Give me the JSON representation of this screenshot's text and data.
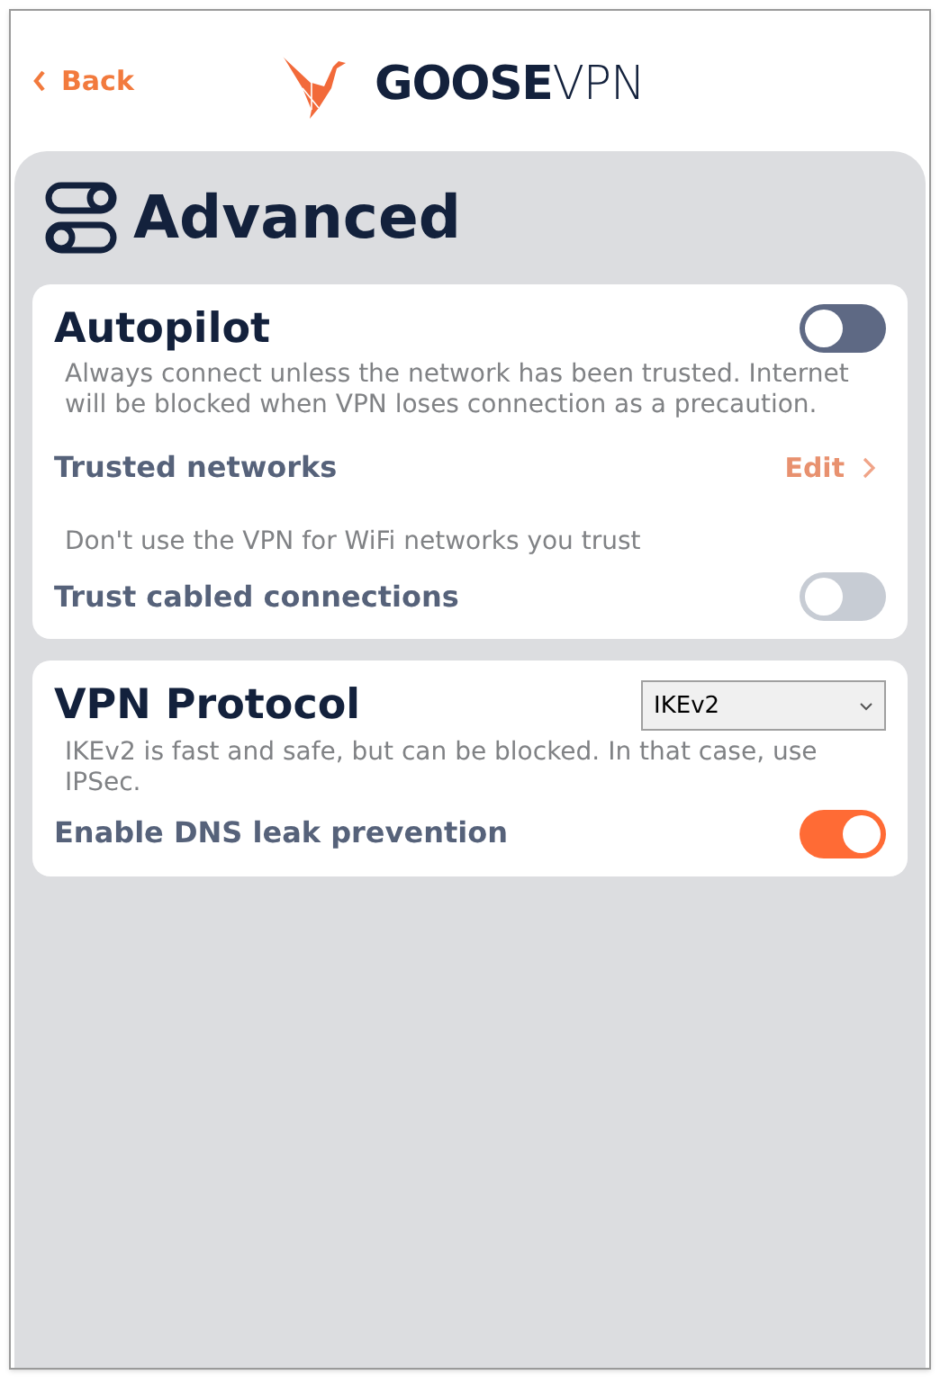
{
  "header": {
    "back": "Back",
    "logo": "**GOOSE**VPN"
  },
  "page": {
    "title": "Advanced"
  },
  "sections": [
    {
      "kind": "toggle",
      "title": "Autopilot",
      "on": false,
      "description": "Always connect unless the network has been trusted. Internet will be blocked when VPN loses connection as a precaution.",
      "rows": [
        {
          "kind": "link",
          "label": "Trusted networks",
          "action": "Edit",
          "disabled": true
        },
        {
          "kind": "note",
          "text": "Don't use the VPN for WiFi networks you trust"
        },
        {
          "kind": "toggle",
          "label": "Trust cabled connections",
          "on": false,
          "disabled": true
        }
      ]
    },
    {
      "kind": "select",
      "title": "VPN Protocol",
      "select": {
        "value": "IKEv2"
      },
      "description": "IKEv2 is fast and safe, but can be blocked. In that case, use IPSec.",
      "rows": [
        {
          "kind": "toggle",
          "label": "Enable DNS leak prevention",
          "on": true,
          "disabled": false
        }
      ]
    }
  ]
}
